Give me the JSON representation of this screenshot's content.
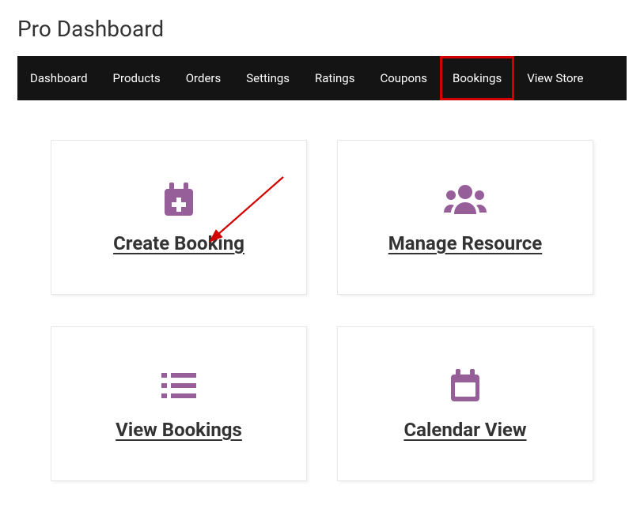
{
  "page_title": "Pro Dashboard",
  "nav": {
    "items": [
      {
        "label": "Dashboard",
        "highlight": false
      },
      {
        "label": "Products",
        "highlight": false
      },
      {
        "label": "Orders",
        "highlight": false
      },
      {
        "label": "Settings",
        "highlight": false
      },
      {
        "label": "Ratings",
        "highlight": false
      },
      {
        "label": "Coupons",
        "highlight": false
      },
      {
        "label": "Bookings",
        "highlight": true
      },
      {
        "label": "View Store",
        "highlight": false
      }
    ]
  },
  "cards": [
    {
      "icon": "calendar-plus-icon",
      "label": "Create Booking",
      "arrow": true
    },
    {
      "icon": "users-icon",
      "label": "Manage Resource",
      "arrow": false
    },
    {
      "icon": "list-icon",
      "label": "View Bookings",
      "arrow": false
    },
    {
      "icon": "calendar-icon",
      "label": "Calendar View",
      "arrow": false
    }
  ],
  "colors": {
    "accent": "#965f9a",
    "highlight": "#d40000"
  }
}
